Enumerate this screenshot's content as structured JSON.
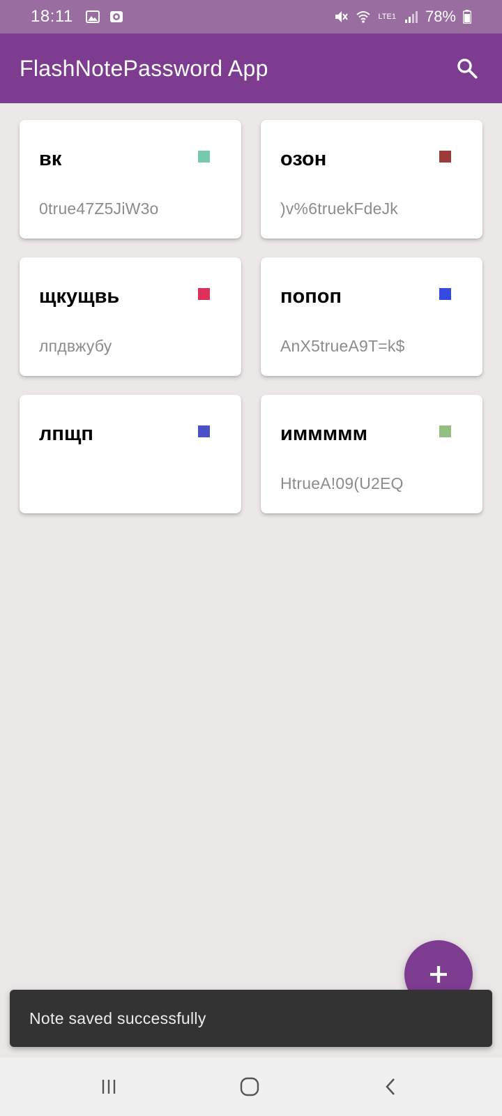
{
  "status_bar": {
    "time": "18:11",
    "battery": "78%",
    "network_label": "LTE1",
    "icons": [
      "image-icon",
      "record-icon",
      "mute-icon",
      "wifi-icon",
      "signal-icon",
      "battery-icon"
    ]
  },
  "app_bar": {
    "title": "FlashNotePassword App",
    "search_icon": "search-icon",
    "background_color": "#7d3c8f"
  },
  "notes": [
    {
      "title": "вк",
      "password": "0true47Z5JiW3o",
      "color": "#76c9ab"
    },
    {
      "title": "озон",
      "password": ")v%6truekFdeJk",
      "color": "#9c3b37"
    },
    {
      "title": "щкущвь",
      "password": "лпдвжубу",
      "color": "#de2f59"
    },
    {
      "title": "попоп",
      "password": "AnX5trueA9T=k$",
      "color": "#3549e3"
    },
    {
      "title": "лпщп",
      "password": "",
      "color": "#4950c8"
    },
    {
      "title": "иммммм",
      "password": "HtrueA!09(U2EQ",
      "color": "#94bf80"
    }
  ],
  "fab": {
    "icon": "plus-icon"
  },
  "snackbar": {
    "text": "Note saved successfully"
  },
  "nav_bar": {
    "icons": [
      "recents-icon",
      "home-icon",
      "back-icon"
    ]
  }
}
